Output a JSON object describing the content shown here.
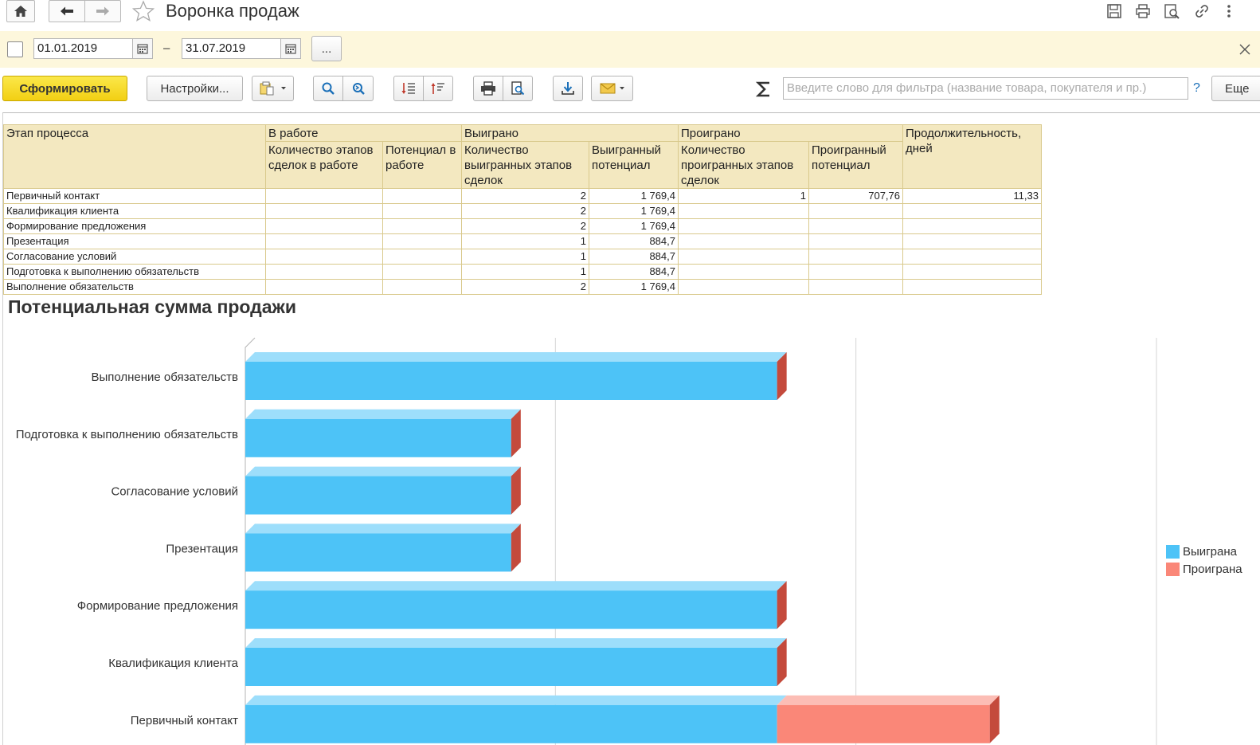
{
  "window": {
    "title": "Воронка продаж"
  },
  "period": {
    "start": "01.01.2019",
    "dash": "–",
    "end": "31.07.2019",
    "more_label": "..."
  },
  "toolbar": {
    "generate_label": "Сформировать",
    "settings_label": "Настройки...",
    "filter_placeholder": "Введите слово для фильтра (название товара, покупателя и пр.)",
    "help_label": "?",
    "more_label": "Еще"
  },
  "table": {
    "headers": {
      "stage": "Этап процесса",
      "in_work": "В работе",
      "won": "Выиграно",
      "lost": "Проиграно",
      "duration": "Продолжительность, дней",
      "in_work_count": "Количество этапов сделок в работе",
      "in_work_potential": "Потенциал в работе",
      "won_count": "Количество выигранных этапов сделок",
      "won_potential": "Выигранный потенциал",
      "lost_count": "Количество проигранных этапов сделок",
      "lost_potential": "Проигранный потенциал"
    },
    "rows": [
      {
        "stage": "Первичный контакт",
        "in_work_count": "",
        "in_work_potential": "",
        "won_count": "2",
        "won_potential": "1 769,4",
        "lost_count": "1",
        "lost_potential": "707,76",
        "duration": "11,33"
      },
      {
        "stage": "Квалификация клиента",
        "in_work_count": "",
        "in_work_potential": "",
        "won_count": "2",
        "won_potential": "1 769,4",
        "lost_count": "",
        "lost_potential": "",
        "duration": ""
      },
      {
        "stage": "Формирование предложения",
        "in_work_count": "",
        "in_work_potential": "",
        "won_count": "2",
        "won_potential": "1 769,4",
        "lost_count": "",
        "lost_potential": "",
        "duration": ""
      },
      {
        "stage": "Презентация",
        "in_work_count": "",
        "in_work_potential": "",
        "won_count": "1",
        "won_potential": "884,7",
        "lost_count": "",
        "lost_potential": "",
        "duration": ""
      },
      {
        "stage": "Согласование условий",
        "in_work_count": "",
        "in_work_potential": "",
        "won_count": "1",
        "won_potential": "884,7",
        "lost_count": "",
        "lost_potential": "",
        "duration": ""
      },
      {
        "stage": "Подготовка к выполнению обязательств",
        "in_work_count": "",
        "in_work_potential": "",
        "won_count": "1",
        "won_potential": "884,7",
        "lost_count": "",
        "lost_potential": "",
        "duration": ""
      },
      {
        "stage": "Выполнение обязательств",
        "in_work_count": "",
        "in_work_potential": "",
        "won_count": "2",
        "won_potential": "1 769,4",
        "lost_count": "",
        "lost_potential": "",
        "duration": ""
      }
    ]
  },
  "chart_data": {
    "type": "bar",
    "orientation": "horizontal",
    "stacked": true,
    "style": "3d",
    "title": "Потенциальная сумма продажи",
    "categories": [
      "Выполнение обязательств",
      "Подготовка к выполнению обязательств",
      "Согласование условий",
      "Презентация",
      "Формирование предложения",
      "Квалификация клиента",
      "Первичный контакт"
    ],
    "series": [
      {
        "name": "Выиграна",
        "color": "#4dc3f7",
        "values": [
          1769.4,
          884.7,
          884.7,
          884.7,
          1769.4,
          1769.4,
          1769.4
        ]
      },
      {
        "name": "Проиграна",
        "color": "#fa8778",
        "values": [
          0,
          0,
          0,
          0,
          0,
          0,
          707.76
        ]
      }
    ],
    "xlim": [
      0,
      3000
    ],
    "gridlines": true,
    "legend_position": "right"
  }
}
